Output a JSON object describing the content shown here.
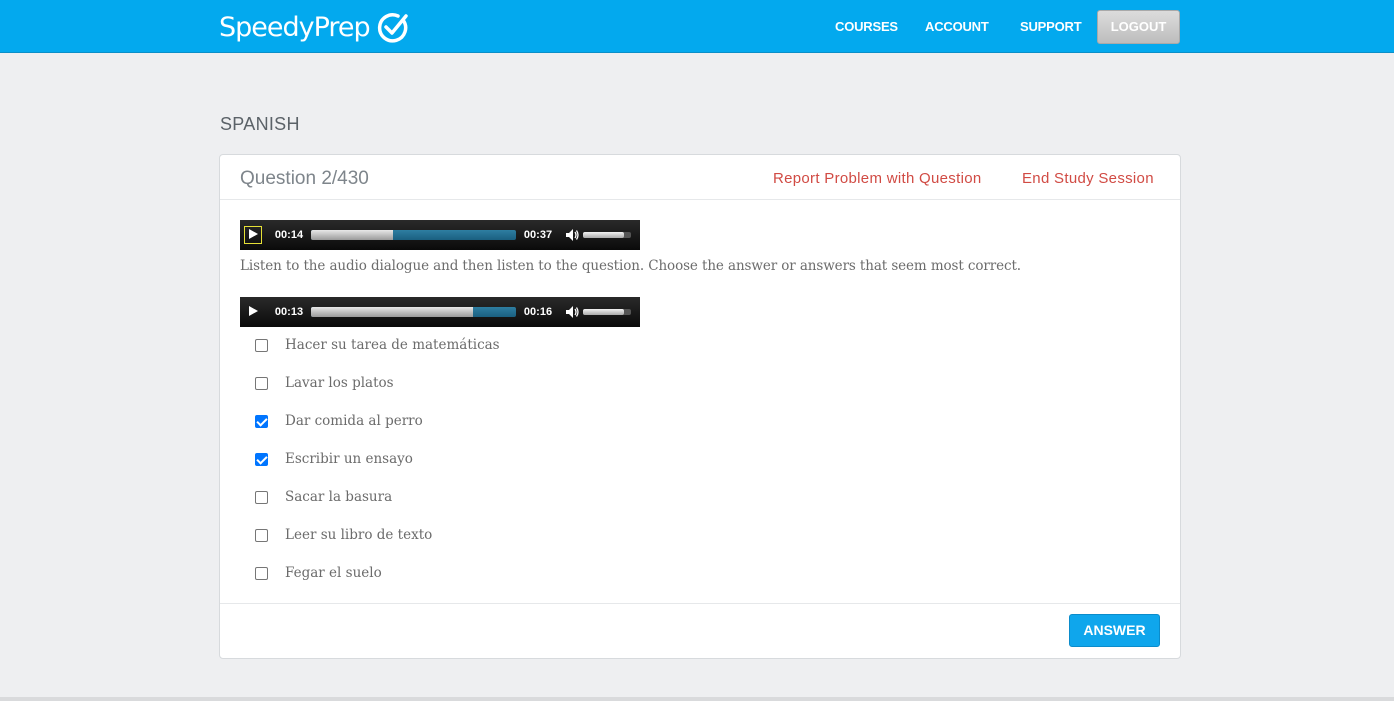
{
  "brand": {
    "name": "SpeedyPrep",
    "logo_icon": "check-circle-icon"
  },
  "nav": {
    "courses": "COURSES",
    "account": "ACCOUNT",
    "support": "SUPPORT",
    "logout": "LOGOUT"
  },
  "page": {
    "section_title": "SPANISH"
  },
  "question": {
    "counter": "Question 2/430",
    "report_link": "Report Problem with Question",
    "end_link": "End Study Session",
    "instructions": "Listen to the audio dialogue and then listen to the question. Choose the answer or answers that seem most correct."
  },
  "players": [
    {
      "current": "00:14",
      "duration": "00:37",
      "progress": 0.4,
      "volume": 0.85
    },
    {
      "current": "00:13",
      "duration": "00:16",
      "progress": 0.79,
      "volume": 0.85
    }
  ],
  "options": [
    {
      "label": "Hacer su tarea de matemáticas",
      "checked": false
    },
    {
      "label": "Lavar los platos",
      "checked": false
    },
    {
      "label": "Dar comida al perro",
      "checked": true
    },
    {
      "label": "Escribir un ensayo",
      "checked": true
    },
    {
      "label": "Sacar la basura",
      "checked": false
    },
    {
      "label": "Leer su libro de texto",
      "checked": false
    },
    {
      "label": "Fegar el suelo",
      "checked": false
    }
  ],
  "footer": {
    "answer_button": "ANSWER"
  },
  "colors": {
    "topbar": "#03a9ee",
    "link_red": "#d14b44",
    "answer_blue": "#0fa6ec",
    "checkbox_checked": "#0075ff"
  }
}
